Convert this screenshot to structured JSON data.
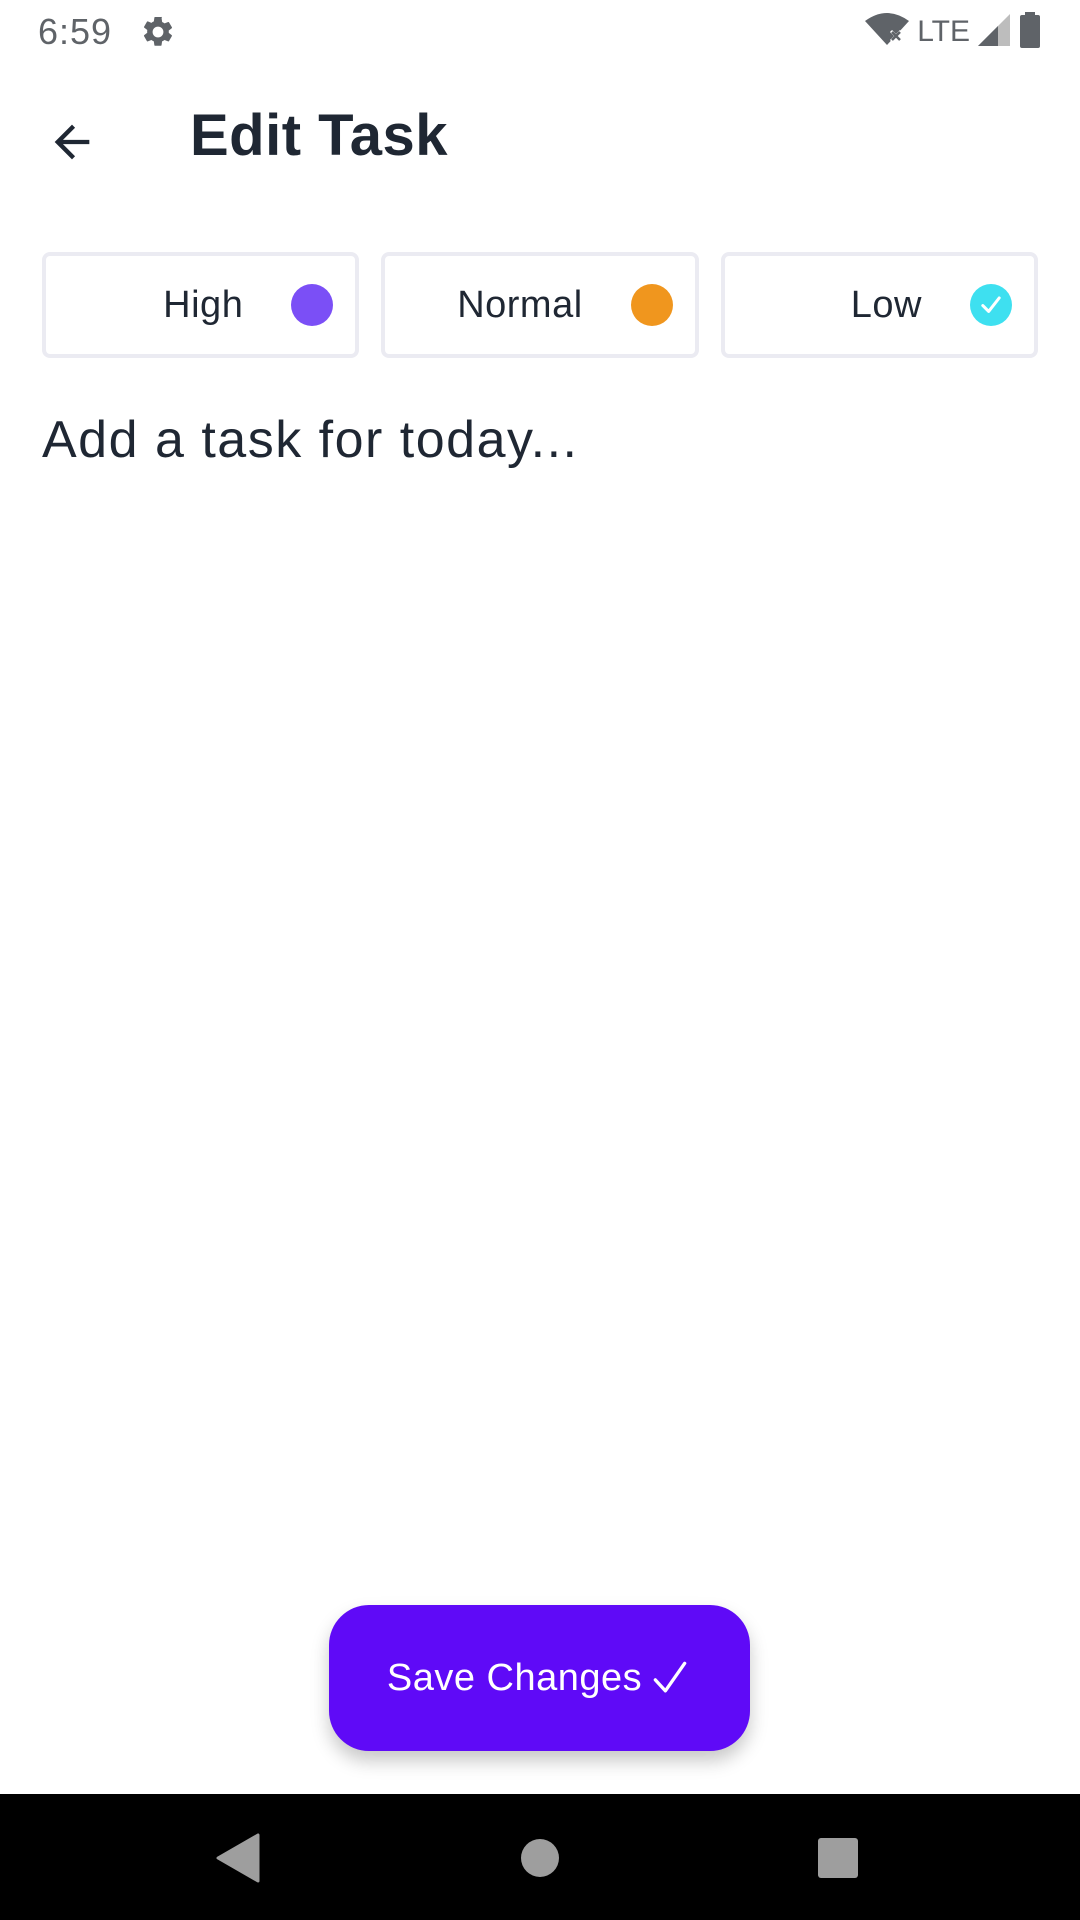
{
  "status_bar": {
    "time": "6:59",
    "network": "LTE",
    "icons": [
      "gear-icon",
      "wifi-off-icon",
      "signal-icon",
      "battery-icon"
    ]
  },
  "header": {
    "title": "Edit Task",
    "back_icon": "arrow-left-icon"
  },
  "priorities": [
    {
      "label": "High",
      "color": "#7b4ff6",
      "selected": false
    },
    {
      "label": "Normal",
      "color": "#f0961e",
      "selected": false
    },
    {
      "label": "Low",
      "color": "#3ee0f0",
      "selected": true
    }
  ],
  "task_input": {
    "placeholder": "Add a task for today...",
    "value": ""
  },
  "save_button": {
    "label": "Save Changes",
    "icon": "checkmark-icon",
    "color": "#5f0af7"
  },
  "nav_bar": {
    "icons": [
      "back-triangle-icon",
      "home-circle-icon",
      "recents-square-icon"
    ]
  }
}
